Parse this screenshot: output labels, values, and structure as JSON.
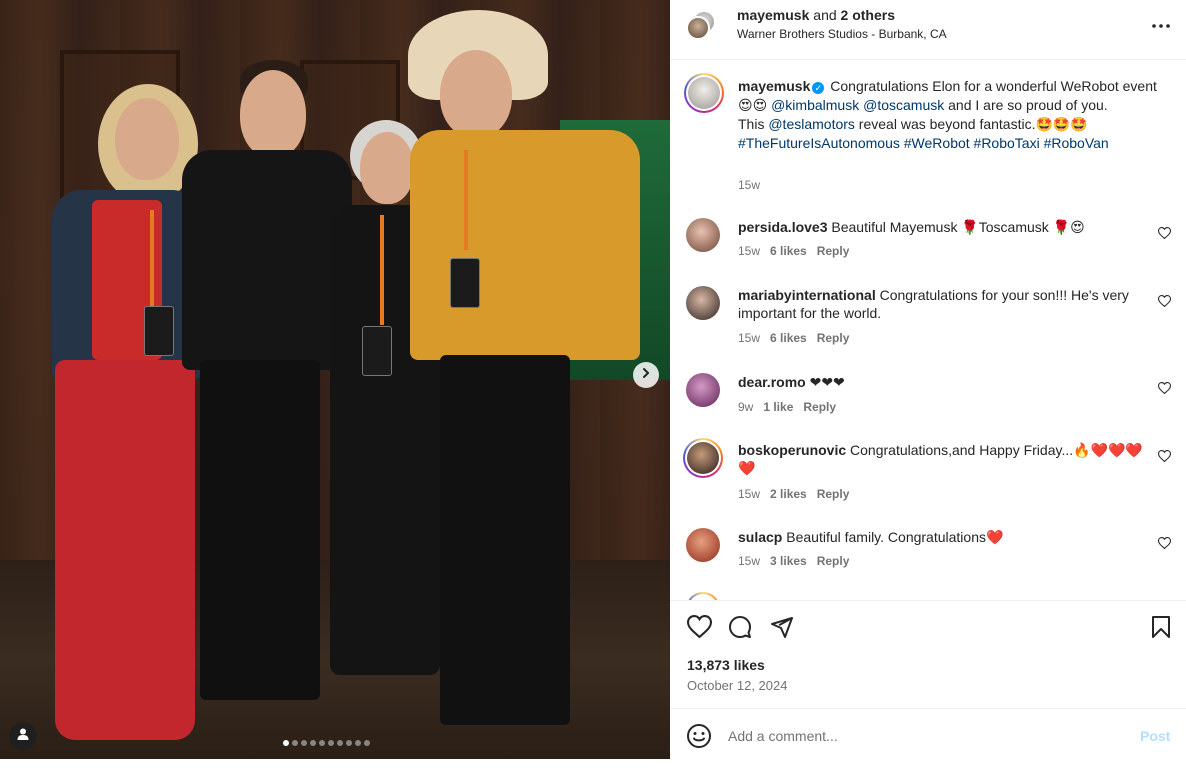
{
  "header": {
    "username": "mayemusk",
    "and_text": " and ",
    "others": "2 others",
    "location": "Warner Brothers Studios - Burbank, CA"
  },
  "caption": {
    "username": "mayemusk",
    "text_1": " Congratulations Elon for a wonderful WeRobot event😍😍 ",
    "mention_1": "@kimbalmusk",
    "mention_2": "@toscamusk",
    "text_2": " and I are so proud of you.",
    "text_3": "This ",
    "mention_3": "@teslamotors",
    "text_4": " reveal was beyond fantastic.🤩🤩🤩",
    "hashtags": "#TheFutureIsAutonomous #WeRobot #RoboTaxi #RoboVan",
    "time": "15w"
  },
  "comments": [
    {
      "username": "persida.love3",
      "text": " Beautiful Mayemusk 🌹Toscamusk 🌹😍",
      "time": "15w",
      "likes": "6 likes",
      "reply": "Reply"
    },
    {
      "username": "mariabyinternational",
      "text": " Congratulations for your son!!! He's very important for the world.",
      "time": "15w",
      "likes": "6 likes",
      "reply": "Reply"
    },
    {
      "username": "dear.romo",
      "text": " ❤❤❤",
      "time": "9w",
      "likes": "1 like",
      "reply": "Reply"
    },
    {
      "username": "boskoperunovic",
      "text": " Congratulations,and Happy Friday...🔥❤️❤️❤️❤️",
      "time": "15w",
      "likes": "2 likes",
      "reply": "Reply"
    },
    {
      "username": "sulacp",
      "text": " Beautiful family. Congratulations❤️",
      "time": "15w",
      "likes": "3 likes",
      "reply": "Reply"
    }
  ],
  "actions": {
    "likes": "13,873 likes",
    "date": "October 12, 2024"
  },
  "comment_box": {
    "placeholder": "Add a comment...",
    "post_label": "Post"
  },
  "icons": {
    "more": "more-horizontal-icon",
    "like": "heart-icon",
    "comment": "comment-icon",
    "share": "share-icon",
    "save": "bookmark-icon",
    "emoji": "emoji-icon",
    "next": "chevron-right-icon",
    "tag": "user-tag-icon"
  },
  "colors": {
    "link": "#00376b",
    "verified": "#0095f6",
    "post_disabled": "#b2dffc",
    "muted": "#737373"
  }
}
